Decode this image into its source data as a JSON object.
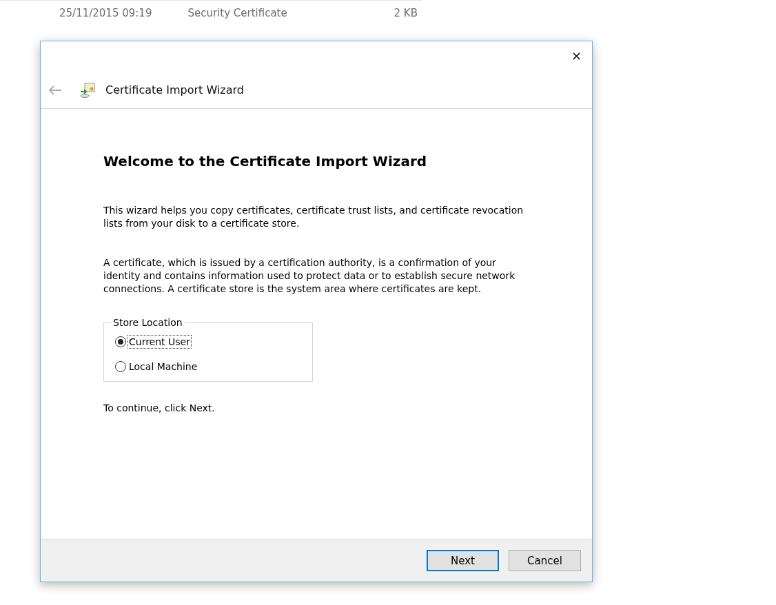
{
  "background_file_row": {
    "date_modified": "25/11/2015 09:19",
    "type": "Security Certificate",
    "size": "2 KB"
  },
  "dialog": {
    "title": "Certificate Import Wizard",
    "close": "✕",
    "heading": "Welcome to the Certificate Import Wizard",
    "paragraphs": [
      "This wizard helps you copy certificates, certificate trust lists, and certificate revocation lists from your disk to a certificate store.",
      "A certificate, which is issued by a certification authority, is a confirmation of your identity and contains information used to protect data or to establish secure network connections. A certificate store is the system area where certificates are kept."
    ],
    "store_location": {
      "legend": "Store Location",
      "options": [
        {
          "label": "Current User",
          "selected": true
        },
        {
          "label": "Local Machine",
          "selected": false
        }
      ]
    },
    "instruction": "To continue, click Next.",
    "buttons": [
      {
        "label": "Next",
        "default": true
      },
      {
        "label": "Cancel",
        "default": false
      }
    ]
  }
}
